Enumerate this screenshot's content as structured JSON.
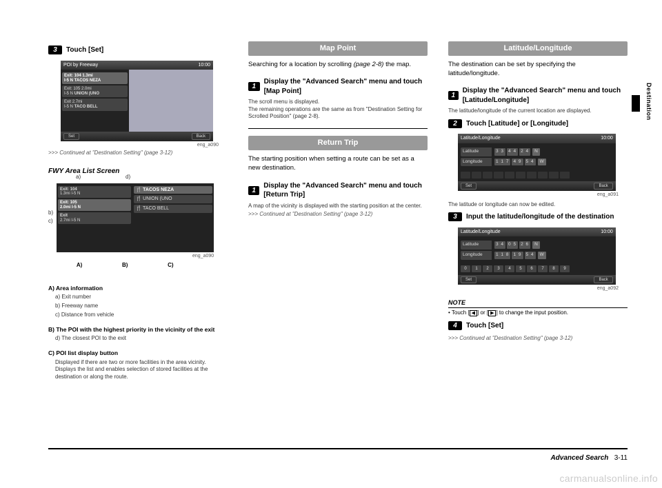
{
  "side_tab": "Destination",
  "footer": {
    "section": "Advanced Search",
    "page": "3-11"
  },
  "watermark": "carmanualsonline.info",
  "col1": {
    "step3": "Touch [Set]",
    "shot1": {
      "title": "POI by Freeway",
      "time": "10:00",
      "rows": [
        {
          "exit": "Exit: 104",
          "dist": "1.3mi",
          "fwy": "I-5 N",
          "poi": "TACOS NEZA"
        },
        {
          "exit": "Exit: 105",
          "dist": "2.0mi",
          "fwy": "I-5 N",
          "poi": "UNION (UNO"
        },
        {
          "exit": "Exit",
          "dist": "2.7mi",
          "fwy": "I-5 N",
          "poi": "TACO BELL"
        }
      ],
      "set": "Set",
      "back": "Back",
      "caption": "eng_a090"
    },
    "continued1": ">>> Continued at \"Destination Setting\" (page 3-12)",
    "subhead": "FWY Area List Screen",
    "callouts_top": {
      "a": "a)",
      "d": "d)"
    },
    "callouts_left_b": "b)",
    "callouts_left_c": "c)",
    "callouts_bottom": {
      "A": "A)",
      "B": "B)",
      "C": "C)"
    },
    "defA_t": "A) Area information",
    "defA_a": "a) Exit number",
    "defA_b": "b) Freeway name",
    "defA_c": "c) Distance from vehicle",
    "defB_t": "B) The POI with the highest priority in the vicinity of the exit",
    "defB_d": "d) The closest POI to the exit",
    "defC_t": "C) POI list display button",
    "defC_body": "Displayed if there are two or more facilities in the area vicinity. Displays the list and enables selection of stored facilities at the destination or along the route."
  },
  "col2": {
    "sec1_title": "Map Point",
    "sec1_body": "Searching for a location by scrolling ",
    "sec1_ref": "(page 2-8)",
    "sec1_body2": " the map.",
    "step1a": "Display the \"Advanced Search\" menu and touch [Map Point]",
    "step1a_note1": "The scroll menu is displayed.",
    "step1a_note2": "The remaining operations are the same as from \"Destination Setting for Scrolled Position\" (page 2-8).",
    "sec2_title": "Return Trip",
    "sec2_body": "The starting position when setting a route can be set as a new destination.",
    "step1b": "Display the \"Advanced Search\" menu and touch [Return Trip]",
    "step1b_note": "A map of the vicinity is displayed with the starting position at the center.",
    "continued2": ">>> Continued at \"Destination Setting\" (page 3-12)"
  },
  "col3": {
    "sec_title": "Latitude/Longitude",
    "intro": "The destination can be set by specifying the latitude/longitude.",
    "step1": "Display the \"Advanced Search\" menu and touch [Latitude/Longitude]",
    "step1_note": "The latitude/longitude of the current location are displayed.",
    "step2": "Touch [Latitude] or [Longitude]",
    "shot_a": {
      "title": "Latitude/Longitude",
      "time": "10:00",
      "lat_label": "Latitude",
      "lat_d": [
        "3 3",
        "4 4",
        "2 4"
      ],
      "lat_dir": "N",
      "lon_label": "Longitude",
      "lon_d": [
        "1 1 7",
        "4 9",
        "5 4"
      ],
      "lon_dir": "W",
      "set": "Set",
      "back": "Back",
      "caption": "eng_a091"
    },
    "after_a": "The latitude or longitude can now be edited.",
    "step3": "Input the latitude/longitude of the destination",
    "shot_b": {
      "title": "Latitude/Longitude",
      "time": "10:00",
      "lat_label": "Latitude",
      "lat_d": [
        "3 4",
        "0 5",
        "2 6"
      ],
      "lat_dir": "N",
      "lon_label": "Longitude",
      "lon_d": [
        "1 1 8",
        "1 9",
        "5 4"
      ],
      "lon_dir": "W",
      "keys": [
        "0",
        "1",
        "2",
        "3",
        "4",
        "5",
        "6",
        "7",
        "8",
        "9"
      ],
      "set": "Set",
      "back": "Back",
      "caption": "eng_a092"
    },
    "note_head": "NOTE",
    "note_body_pre": "• Touch [",
    "note_body_mid": "] or [",
    "note_body_post": "] to change the input position.",
    "step4": "Touch [Set]",
    "continued": ">>> Continued at \"Destination Setting\" (page 3-12)"
  }
}
